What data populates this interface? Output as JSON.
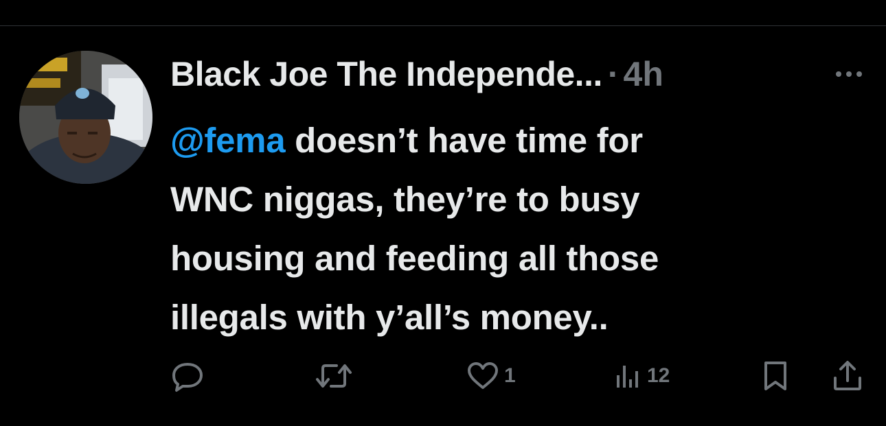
{
  "tweet": {
    "display_name": "Black Joe The Independe...",
    "separator": "·",
    "timestamp": "4h",
    "mention": "@fema",
    "text_line1_rest": " doesn’t have time for",
    "text_line2": "WNC niggas, they’re to busy",
    "text_line3": "housing and feeding all those",
    "text_line4": "illegals with y’all’s money.."
  },
  "actions": {
    "reply_count": "",
    "retweet_count": "",
    "like_count": "1",
    "views_count": "12"
  },
  "colors": {
    "background": "#000000",
    "text": "#e7e9ea",
    "secondary": "#71767b",
    "accent": "#1d9bf0",
    "divider": "#2f3336"
  },
  "icons": {
    "more": "more-horizontal-icon",
    "reply": "reply-bubble-icon",
    "retweet": "retweet-icon",
    "like": "heart-icon",
    "views": "views-bar-chart-icon",
    "bookmark": "bookmark-icon",
    "share": "share-upload-icon"
  }
}
